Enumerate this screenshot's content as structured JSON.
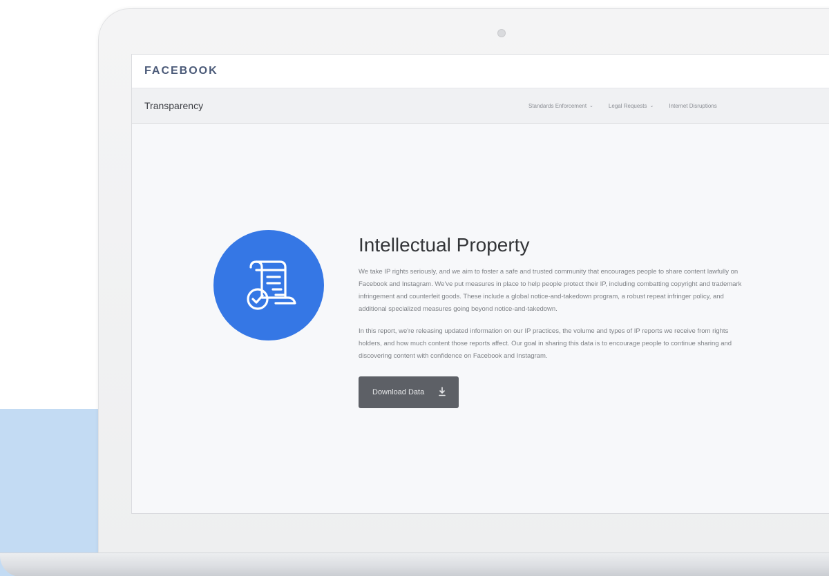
{
  "brand": {
    "name": "FACEBOOK"
  },
  "nav": {
    "title": "Transparency",
    "links": [
      {
        "label": "Standards Enforcement",
        "has_dropdown": true
      },
      {
        "label": "Legal Requests",
        "has_dropdown": true
      },
      {
        "label": "Internet Disruptions",
        "has_dropdown": false
      }
    ],
    "caret_glyph": "⌄"
  },
  "hero": {
    "icon": "ip-document-check-icon",
    "accent_color": "#3577e5"
  },
  "main": {
    "title": "Intellectual Property",
    "paragraph1": "We take IP rights seriously, and we aim to foster a safe and trusted community that encourages people to share content lawfully on Facebook and Instagram. We've put measures in place to help people protect their IP, including combatting copyright and trademark infringement and counterfeit goods. These include a global notice-and-takedown program, a robust repeat infringer policy, and additional specialized measures going beyond notice-and-takedown.",
    "paragraph2": "In this report, we're releasing updated information on our IP practices, the volume and types of IP reports we receive from rights holders, and how much content those reports affect. Our goal in sharing this data is to encourage people to continue sharing and discovering content with confidence on Facebook and Instagram.",
    "download_label": "Download Data",
    "download_icon": "download-icon"
  },
  "colors": {
    "background_block": "#c3dbf3",
    "button": "#5d6066",
    "brand_text": "#4b5a78"
  }
}
